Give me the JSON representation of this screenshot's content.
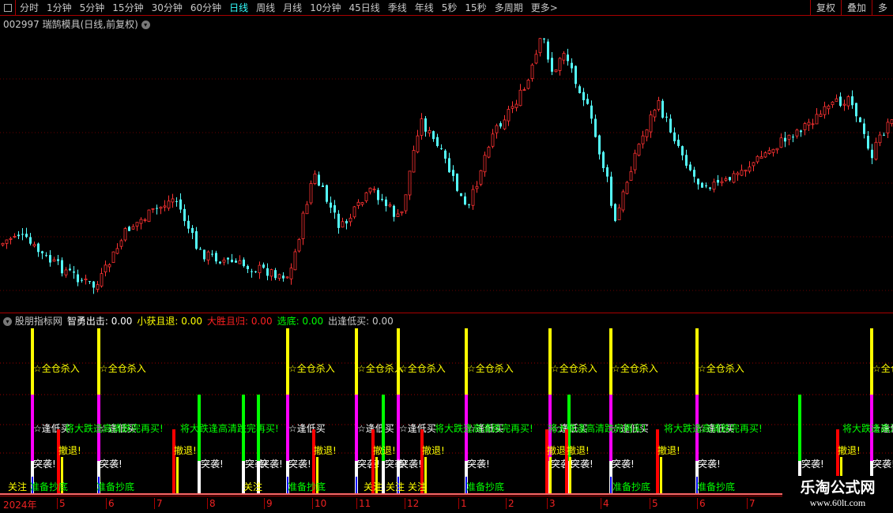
{
  "toolbar": {
    "periods": [
      "分时",
      "1分钟",
      "5分钟",
      "15分钟",
      "30分钟",
      "60分钟",
      "日线",
      "周线",
      "月线",
      "10分钟",
      "45日线",
      "季线",
      "年线",
      "5秒",
      "15秒",
      "多周期",
      "更多>"
    ],
    "active": "日线",
    "right": [
      "复权",
      "叠加",
      "多"
    ]
  },
  "stock": {
    "title": "002997 瑞鹄模具(日线,前复权)"
  },
  "indicator": {
    "name": "股朋指标网",
    "items": [
      {
        "label": "智勇出击:",
        "value": "0.00",
        "color": "#ffffff"
      },
      {
        "label": "小获且退:",
        "value": "0.00",
        "color": "#ffff00"
      },
      {
        "label": "大胜且归:",
        "value": "0.00",
        "color": "#ff2020"
      },
      {
        "label": "选底:",
        "value": "0.00",
        "color": "#00ff00"
      },
      {
        "label": "出逢低买:",
        "value": "0.00",
        "color": "#c8c8c8"
      }
    ]
  },
  "signals": {
    "buy_all": "☆全仓杀入",
    "buy_low": "☆逢低买",
    "wait": "将大跌逢高清跌完再买!",
    "retreat": "撤退!",
    "raid": "突袭!",
    "watch": "关注",
    "bottom": "准备抄底"
  },
  "colors": {
    "up": "#ff3232",
    "down": "#54fcfc",
    "grid": "#a00000"
  },
  "date_axis": [
    "2024年",
    "5",
    "6",
    "7",
    "8",
    "9",
    "10",
    "11",
    "12",
    "1",
    "2",
    "3",
    "4",
    "5",
    "6",
    "7"
  ],
  "watermark": {
    "name": "乐淘公式网",
    "url": "www.60lt.com"
  }
}
